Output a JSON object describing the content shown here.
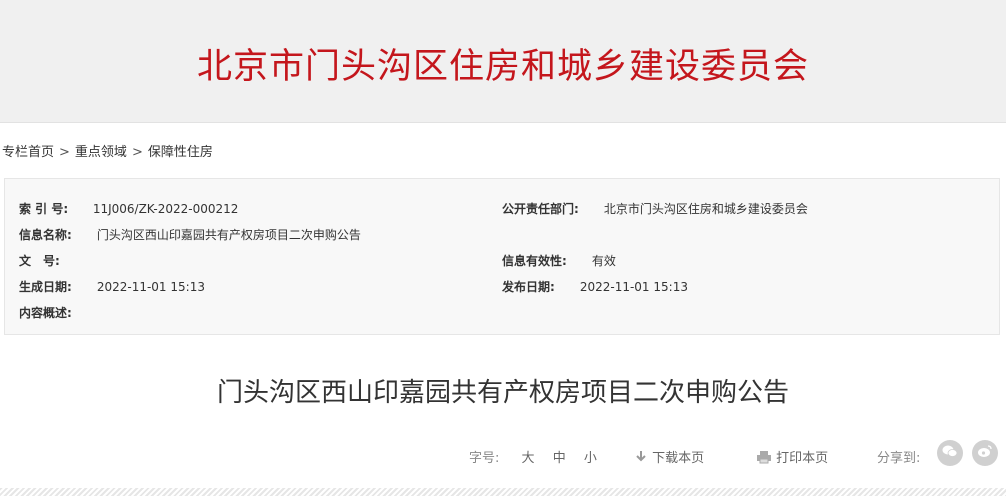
{
  "banner": {
    "title": "北京市门头沟区住房和城乡建设委员会"
  },
  "breadcrumb": {
    "items": [
      "专栏首页",
      "重点领域",
      "保障性住房"
    ],
    "separator": ">"
  },
  "info": {
    "index_label": "索 引 号:",
    "index_value": "11J006/ZK-2022-000212",
    "dept_label": "公开责任部门:",
    "dept_value": "北京市门头沟区住房和城乡建设委员会",
    "name_label": "信息名称:",
    "name_value": "门头沟区西山印嘉园共有产权房项目二次申购公告",
    "docno_label": "文　号:",
    "docno_value": "",
    "validity_label": "信息有效性:",
    "validity_value": "有效",
    "created_label": "生成日期:",
    "created_value": "2022-11-01 15:13",
    "published_label": "发布日期:",
    "published_value": "2022-11-01 15:13",
    "summary_label": "内容概述:",
    "summary_value": ""
  },
  "article": {
    "title": "门头沟区西山印嘉园共有产权房项目二次申购公告"
  },
  "toolbar": {
    "font_label": "字号:",
    "font_large": "大",
    "font_medium": "中",
    "font_small": "小",
    "download_label": "下载本页",
    "print_label": "打印本页",
    "share_label": "分享到:"
  },
  "icons": {
    "download": "download-icon",
    "print": "printer-icon",
    "wechat": "wechat-icon",
    "weibo": "weibo-icon"
  },
  "colors": {
    "brand_red": "#c4161c",
    "banner_bg": "#f0f0f0",
    "info_bg": "#f8f8f8"
  }
}
